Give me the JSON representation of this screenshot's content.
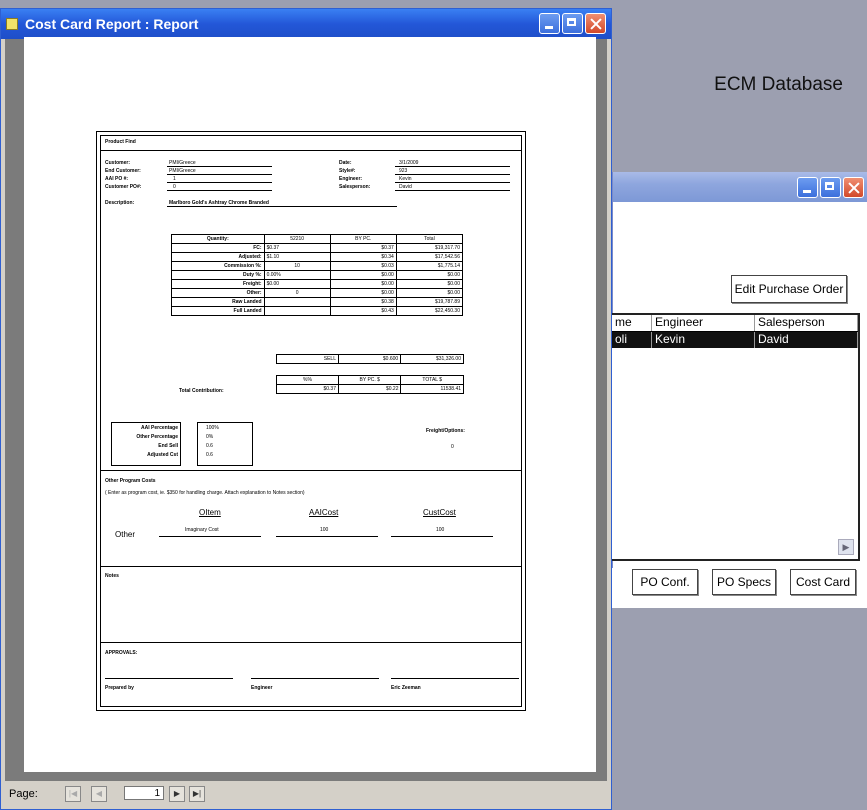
{
  "main_window": {
    "title": "Cost Card Report : Report"
  },
  "report": {
    "product_find": "Product Find",
    "customer_label": "Customer:",
    "customer_value": "PMI/Greece",
    "end_customer_label": "End Customer:",
    "end_customer_value": "PMI/Greece",
    "aai_po_label": "AAI PO #:",
    "aai_po_value": "1",
    "customer_po_label": "Customer PO#:",
    "customer_po_value": "0",
    "date_label": "Date:",
    "date_value": "3/1/2009",
    "style_label": "Style#:",
    "style_value": "923",
    "engineer_label": "Engineer:",
    "engineer_value": "Kevin",
    "salesperson_label": "Salesperson:",
    "salesperson_value": "David",
    "description_label": "Description:",
    "description_value": "Marlboro Gold's Ashtray Chrome Branded",
    "cost_headers": [
      "Quantity:",
      "52210",
      "BY PC.",
      "Total"
    ],
    "cost_rows": [
      [
        "FC:",
        "$0.37",
        "$0.37",
        "$19,317.70"
      ],
      [
        "Adjusted:",
        "$1.10",
        "$0.34",
        "$17,542.56"
      ],
      [
        "Commission %:",
        "10",
        "$0.03",
        "$1,775.14"
      ],
      [
        "Duty %:",
        "0.00%",
        "$0.00",
        "$0.00"
      ],
      [
        "Freight:",
        "$0.00",
        "$0.00",
        "$0.00"
      ],
      [
        "Other:",
        "0",
        "$0.00",
        "$0.00"
      ],
      [
        "Raw Landed",
        "",
        "$0.38",
        "$19,787.89"
      ],
      [
        "Full Landed",
        "",
        "$0.43",
        "$22,450.30"
      ]
    ],
    "sell_row": [
      "SELL",
      "$0.600",
      "$31,326.00"
    ],
    "contrib_headers": [
      "%%",
      "BY PC. $",
      "TOTAL $"
    ],
    "contrib_label": "Total Contribution:",
    "contrib_values": [
      "$0.37",
      "$0.22",
      "11538.41"
    ],
    "percent_labels": [
      "AAI Percentage",
      "Other Percentage",
      "End Sell",
      "Adjusted Cst"
    ],
    "percent_values": [
      "100%",
      "0%",
      "0.6",
      "0.6"
    ],
    "freight_label": "Freight/Options:",
    "freight_value": "0",
    "other_costs_title": "Other Program Costs",
    "other_costs_note": "( Enter as program cost, ie. $350 for handling charge. Attach explanation to Notes section)",
    "col_other_item": "OItem",
    "col_aai_cost": "AAICost",
    "col_cust_cost": "CustCost",
    "other_label": "Other",
    "other_item": "Imaginary Cost",
    "other_aai": "100",
    "other_cust": "100",
    "notes_label": "Notes",
    "approvals_label": "APPROVALS:",
    "prepared_by": "Prepared by",
    "engineer_sign": "Engineer",
    "third_sign": "Eric Zeeman"
  },
  "status_bar": {
    "page_label": "Page:",
    "page_number": "1"
  },
  "bg_window": {
    "title": "ECM Database",
    "edit_po_button": "Edit Purchase Order",
    "grid_headers": [
      "me",
      "Engineer",
      "Salesperson"
    ],
    "grid_row": [
      "oli",
      "Kevin",
      "David"
    ],
    "po_conf_button": "PO Conf.",
    "po_specs_button": "PO Specs",
    "cost_card_button": "Cost Card"
  }
}
